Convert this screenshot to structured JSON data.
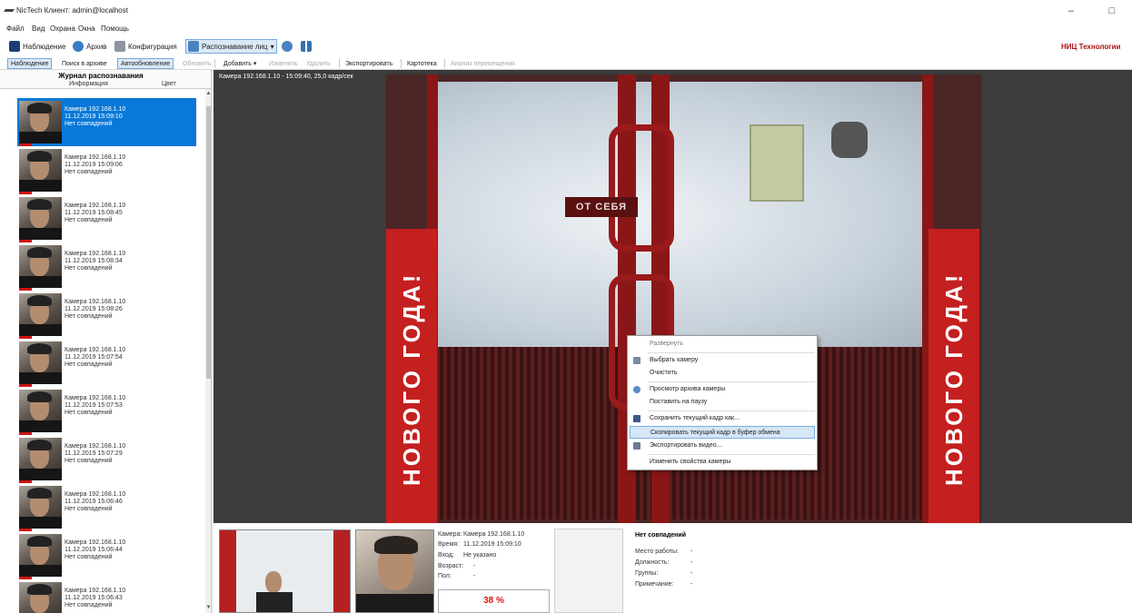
{
  "titlebar": {
    "title": "NicTech Клиент: admin@localhost",
    "minimize": "–",
    "restore": "□"
  },
  "menu": [
    "Файл",
    "Вид",
    "Охрана",
    "Окна",
    "Помощь"
  ],
  "toolbar": {
    "observation": "Наблюдение",
    "archive": "Архив",
    "config": "Конфигурация",
    "face_rec": "Распознавание лиц",
    "brand": "НИЦ Технологии"
  },
  "subtoolbar": {
    "observation": "Наблюдение",
    "archive_search": "Поиск в архиве",
    "autoupdate": "Автообновление",
    "refresh": "Обновить",
    "add": "Добавить ▾",
    "edit": "Изменить",
    "delete": "Удалить",
    "export": "Экспортировать",
    "card": "Картотека",
    "movement": "Анализ перемещения"
  },
  "journal": {
    "title": "Журнал распознавания",
    "col_info": "Информация",
    "col_color": "Цвет",
    "rows": [
      {
        "camera": "Камера 192.168.1.10",
        "time": "11.12.2019 15:09:10",
        "status": "Нет совпадений"
      },
      {
        "camera": "Камера 192.168.1.10",
        "time": "11.12.2019 15:09:06",
        "status": "Нет совпадений"
      },
      {
        "camera": "Камера 192.168.1.10",
        "time": "11.12.2019 15:08:45",
        "status": "Нет совпадений"
      },
      {
        "camera": "Камера 192.168.1.10",
        "time": "11.12.2019 15:08:34",
        "status": "Нет совпадений"
      },
      {
        "camera": "Камера 192.168.1.10",
        "time": "11.12.2019 15:08:26",
        "status": "Нет совпадений"
      },
      {
        "camera": "Камера 192.168.1.10",
        "time": "11.12.2019 15:07:54",
        "status": "Нет совпадений"
      },
      {
        "camera": "Камера 192.168.1.10",
        "time": "11.12.2019 15:07:53",
        "status": "Нет совпадений"
      },
      {
        "camera": "Камера 192.168.1.10",
        "time": "11.12.2019 15:07:29",
        "status": "Нет совпадений"
      },
      {
        "camera": "Камера 192.168.1.10",
        "time": "11.12.2019 15:06:46",
        "status": "Нет совпадений"
      },
      {
        "camera": "Камера 192.168.1.10",
        "time": "11.12.2019 15:06:44",
        "status": "Нет совпадений"
      },
      {
        "camera": "Камера 192.168.1.10",
        "time": "11.12.2019 15:06:43",
        "status": "Нет совпадений"
      }
    ]
  },
  "video": {
    "caption": "Камера 192.168.1.10 - 15:09:40, 25,0 кадр/сек",
    "door_sign": "ОТ СЕБЯ",
    "panel_text": "НОВОГО ГОДА!"
  },
  "context_menu": [
    "Развернуть",
    "Выбрать камеру",
    "Очистить",
    "Просмотр архива камеры",
    "Поставить на паузу",
    "Сохранить текущий кадр как...",
    "Скопировать текущий кадр в буфер обмена",
    "Экспортировать видео...",
    "Изменить свойства камеры"
  ],
  "details": {
    "camera_label": "Камера:",
    "camera": "Камера 192.168.1.10",
    "time_label": "Время:",
    "time": "11.12.2019 15:09:10",
    "entry_label": "Вход:",
    "entry": "Не указано",
    "age_label": "Возраст:",
    "age": "-",
    "sex_label": "Пол:",
    "sex": "-",
    "percent": "38 %",
    "match_title": "Нет совпадений",
    "work_label": "Место работы:",
    "work": "-",
    "position_label": "Должность:",
    "position": "-",
    "groups_label": "Группы:",
    "groups": "-",
    "note_label": "Примечание:",
    "note": "-"
  }
}
